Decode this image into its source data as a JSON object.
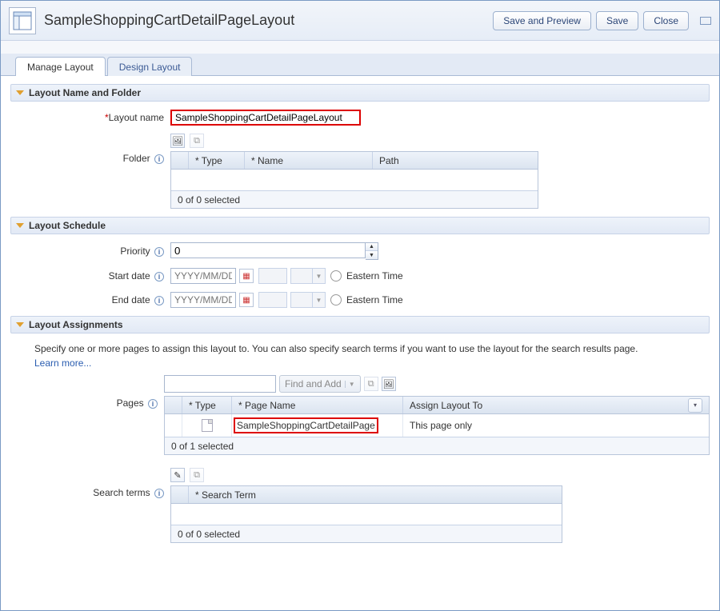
{
  "header": {
    "title": "SampleShoppingCartDetailPageLayout",
    "save_preview_label": "Save and Preview",
    "save_label": "Save",
    "close_label": "Close"
  },
  "tabs": {
    "manage": "Manage Layout",
    "design": "Design Layout"
  },
  "sections": {
    "name_folder": "Layout Name and Folder",
    "schedule": "Layout Schedule",
    "assignments": "Layout Assignments"
  },
  "labels": {
    "layout_name": "Layout name",
    "folder": "Folder",
    "priority": "Priority",
    "start_date": "Start date",
    "end_date": "End date",
    "pages": "Pages",
    "search_terms": "Search terms",
    "find_and_add": "Find and Add",
    "timezone": "Eastern Time"
  },
  "values": {
    "layout_name": "SampleShoppingCartDetailPageLayout",
    "priority": "0",
    "date_placeholder": "YYYY/MM/DD"
  },
  "folder_grid": {
    "col_type": "* Type",
    "col_name": "* Name",
    "col_path": "Path",
    "footer": "0 of 0 selected"
  },
  "pages_grid": {
    "col_type": "* Type",
    "col_page_name": "* Page Name",
    "col_assign": "Assign Layout To",
    "row1_page_name": "SampleShoppingCartDetailPage",
    "row1_assign": "This page only",
    "footer": "0 of 1 selected"
  },
  "search_grid": {
    "col_term": "* Search Term",
    "footer": "0 of 0 selected"
  },
  "assignments_text": {
    "desc": "Specify one or more pages to assign this layout to. You can also specify search terms if you want to use the layout for the search results page.",
    "learn_more": "Learn more..."
  }
}
